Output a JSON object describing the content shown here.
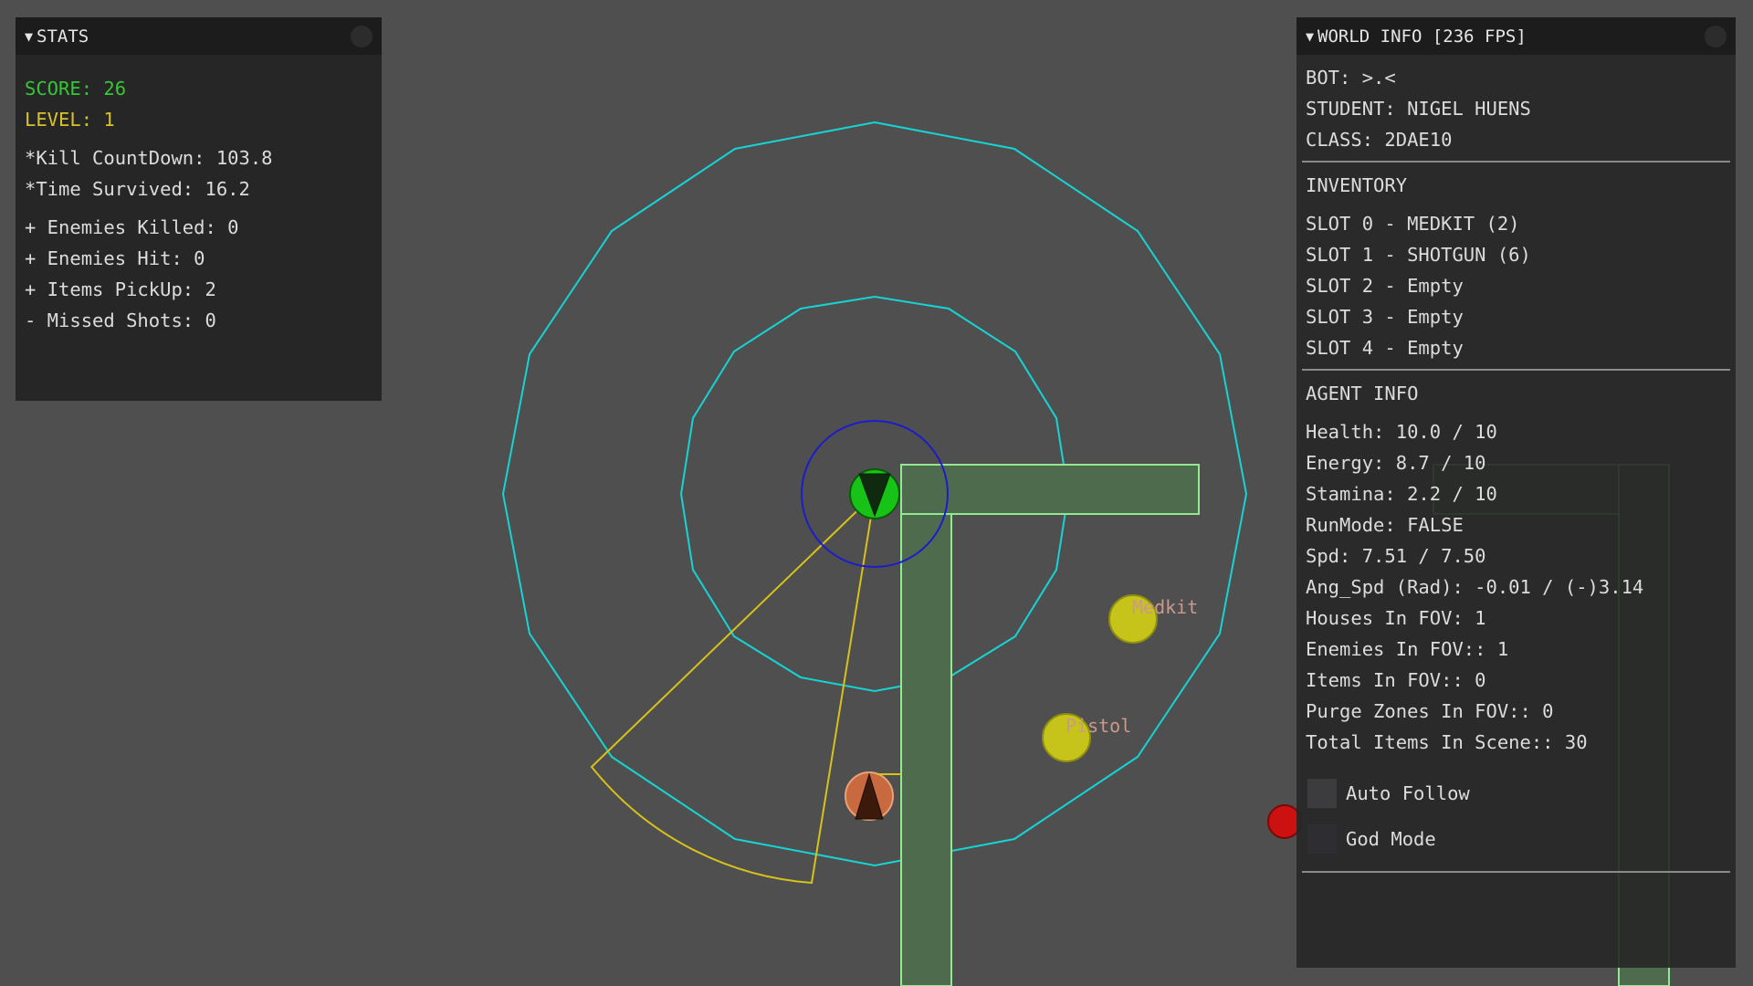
{
  "stats": {
    "title": "STATS",
    "score": "SCORE: 26",
    "level": "LEVEL: 1",
    "kill_countdown": "*Kill CountDown: 103.8",
    "time_survived": "*Time Survived: 16.2",
    "enemies_killed": "+ Enemies Killed: 0",
    "enemies_hit": "+ Enemies Hit: 0",
    "items_pickup": "+ Items PickUp: 2",
    "missed_shots": "- Missed Shots: 0"
  },
  "world_info": {
    "title": "WORLD INFO [236 FPS]",
    "bot": "BOT: >.<",
    "student": "STUDENT: NIGEL HUENS",
    "class": "CLASS: 2DAE10",
    "inventory_header": "INVENTORY",
    "slots": [
      "SLOT 0 - MEDKIT (2)",
      "SLOT 1 - SHOTGUN (6)",
      "SLOT 2 - Empty",
      "SLOT 3 - Empty",
      "SLOT 4 - Empty"
    ],
    "agent_header": "AGENT INFO",
    "health": "Health: 10.0 / 10",
    "energy": "Energy: 8.7 / 10",
    "stamina": "Stamina: 2.2 / 10",
    "run_mode": "RunMode: FALSE",
    "speed": "Spd: 7.51 / 7.50",
    "ang_speed": "Ang_Spd (Rad): -0.01 / (-)3.14",
    "houses_fov": "Houses In FOV: 1",
    "enemies_fov": "Enemies In FOV:: 1",
    "items_fov": "Items In FOV:: 0",
    "purge_fov": "Purge Zones In FOV:: 0",
    "total_items": "Total Items In Scene:: 30",
    "auto_follow_label": "Auto Follow",
    "auto_follow": false,
    "god_mode_label": "God Mode",
    "god_mode": false
  },
  "world": {
    "item_labels": {
      "medkit": "Medkit",
      "pistol": "Pistol"
    },
    "colors": {
      "background": "#4f4f4f",
      "range_ring": "#17d4d4",
      "near_ring": "#1c1ccc",
      "fov_cone": "#d6c21a",
      "house_fill": "#4e6b4e",
      "house_stroke": "#93e893",
      "agent": "#16c316",
      "enemy": "#c9693f",
      "item": "#c6c41a",
      "purge": "#cc1111"
    }
  }
}
